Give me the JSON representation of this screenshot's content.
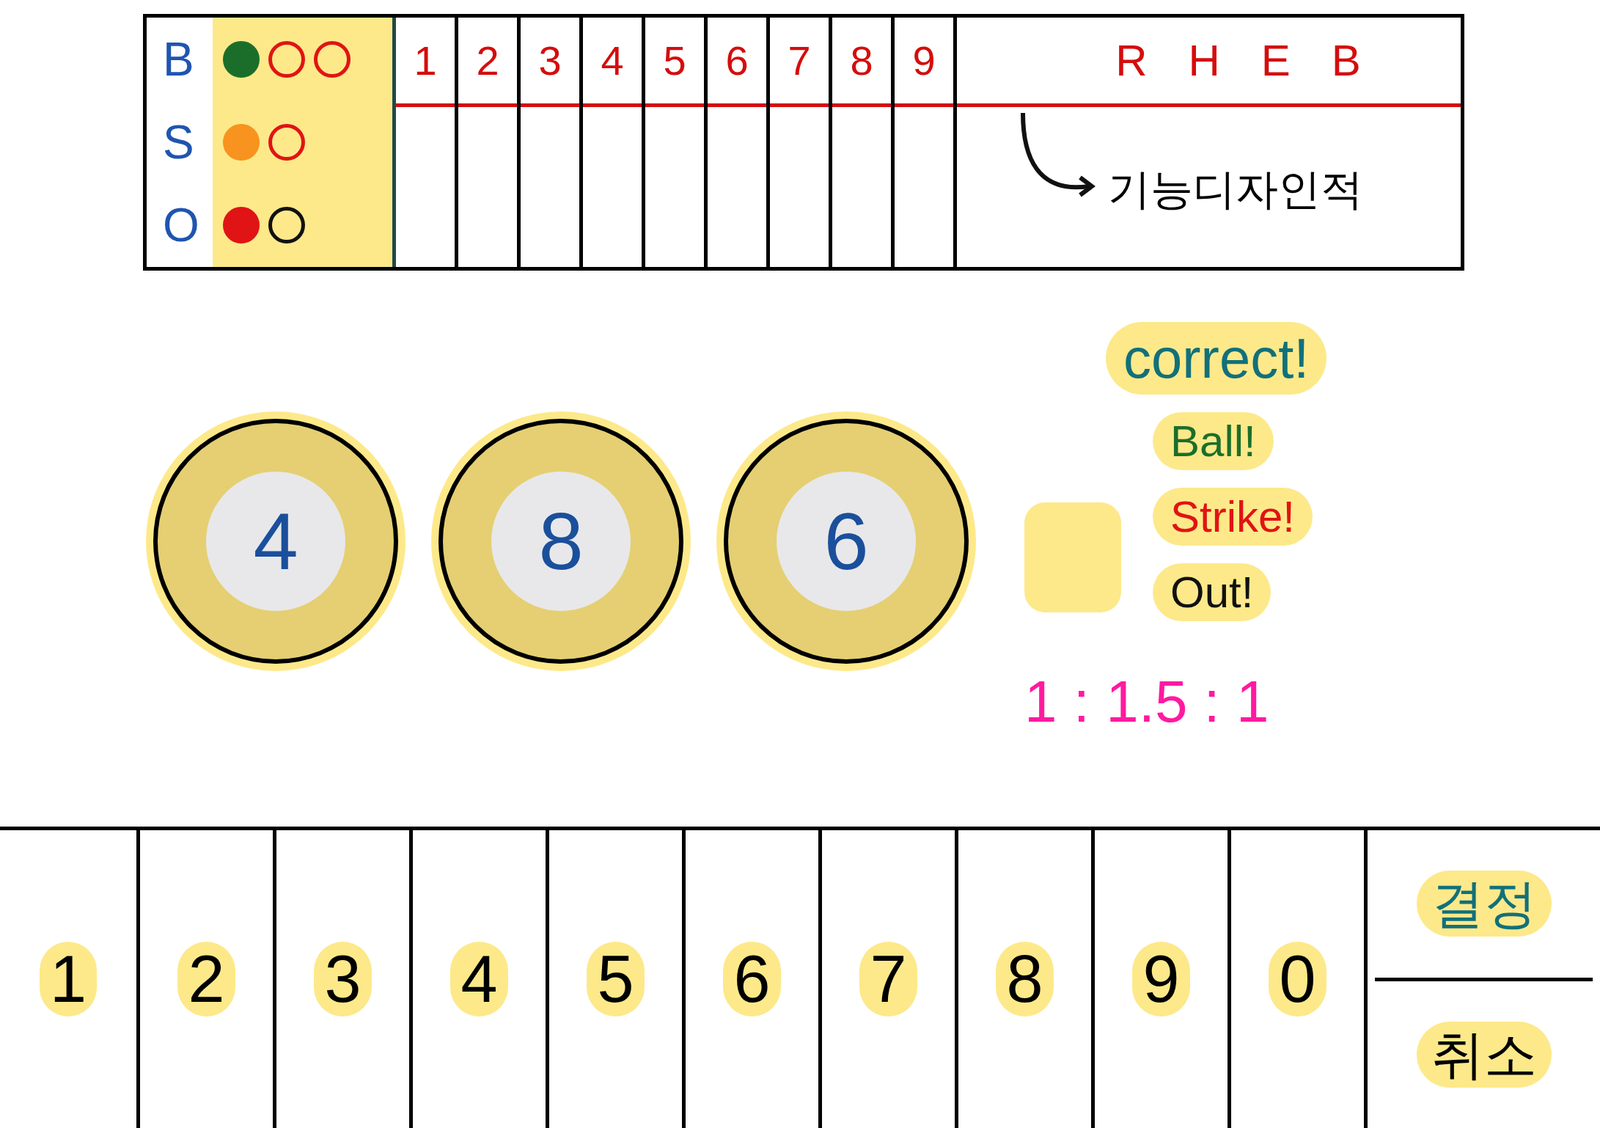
{
  "scoreboard": {
    "rows": [
      {
        "label": "B",
        "dots": [
          {
            "filled": true,
            "color": "#1b6e2a"
          },
          {
            "filled": false,
            "color": "#e01414"
          },
          {
            "filled": false,
            "color": "#e01414"
          }
        ]
      },
      {
        "label": "S",
        "dots": [
          {
            "filled": true,
            "color": "#f7931e"
          },
          {
            "filled": false,
            "color": "#e01414"
          }
        ]
      },
      {
        "label": "O",
        "dots": [
          {
            "filled": true,
            "color": "#e01414"
          },
          {
            "filled": false,
            "color": "#111111"
          }
        ]
      }
    ],
    "innings": [
      "1",
      "2",
      "3",
      "4",
      "5",
      "6",
      "7",
      "8",
      "9"
    ],
    "totals": [
      "R",
      "H",
      "E",
      "B"
    ],
    "note": "기능디자인적"
  },
  "balls": [
    {
      "number": "4"
    },
    {
      "number": "8"
    },
    {
      "number": "6"
    }
  ],
  "results": [
    {
      "label": "correct!",
      "color": "#11707a"
    },
    {
      "label": "Ball!",
      "color": "#1b6e2a"
    },
    {
      "label": "Strike!",
      "color": "#e01414"
    },
    {
      "label": "Out!",
      "color": "#111111"
    }
  ],
  "ratio": "1 : 1.5 : 1",
  "keypad": {
    "keys": [
      "1",
      "2",
      "3",
      "4",
      "5",
      "6",
      "7",
      "8",
      "9",
      "0"
    ],
    "actions": [
      "결정",
      "취소"
    ]
  }
}
